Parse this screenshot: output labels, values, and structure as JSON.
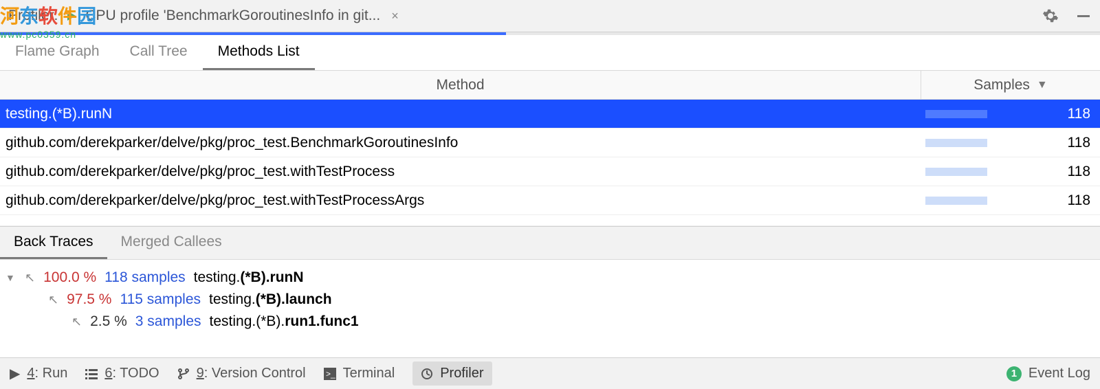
{
  "watermark": {
    "main": "河东软件园",
    "url": "www.pc0359.cn"
  },
  "title": {
    "prefix": "Profiler:",
    "text": "CPU profile 'BenchmarkGoroutinesInfo in git...",
    "close": "×"
  },
  "tabs": {
    "flame": "Flame Graph",
    "calltree": "Call Tree",
    "methods": "Methods List"
  },
  "table": {
    "headers": {
      "method": "Method",
      "samples": "Samples"
    },
    "rows": [
      {
        "method": "testing.(*B).runN",
        "samples": 118,
        "selected": true
      },
      {
        "method": "github.com/derekparker/delve/pkg/proc_test.BenchmarkGoroutinesInfo",
        "samples": 118,
        "selected": false
      },
      {
        "method": "github.com/derekparker/delve/pkg/proc_test.withTestProcess",
        "samples": 118,
        "selected": false
      },
      {
        "method": "github.com/derekparker/delve/pkg/proc_test.withTestProcessArgs",
        "samples": 118,
        "selected": false
      }
    ]
  },
  "subtabs": {
    "back": "Back Traces",
    "merged": "Merged Callees"
  },
  "traces": [
    {
      "indent": 0,
      "disclosure": true,
      "pct": "100.0 %",
      "pct_red": true,
      "samples": "118 samples",
      "prefix": "testing.",
      "bold": "(*B).runN"
    },
    {
      "indent": 1,
      "disclosure": false,
      "pct": "97.5 %",
      "pct_red": true,
      "samples": "115 samples",
      "prefix": "testing.",
      "bold": "(*B).launch"
    },
    {
      "indent": 2,
      "disclosure": false,
      "pct": "2.5 %",
      "pct_red": false,
      "samples": "3 samples",
      "prefix": "testing.(*B).",
      "bold": "run1.func1"
    }
  ],
  "bottom": {
    "run": "4: Run",
    "todo": "6: TODO",
    "vcs": "9: Version Control",
    "terminal": "Terminal",
    "profiler": "Profiler",
    "eventlog": "Event Log",
    "badge": "1"
  }
}
